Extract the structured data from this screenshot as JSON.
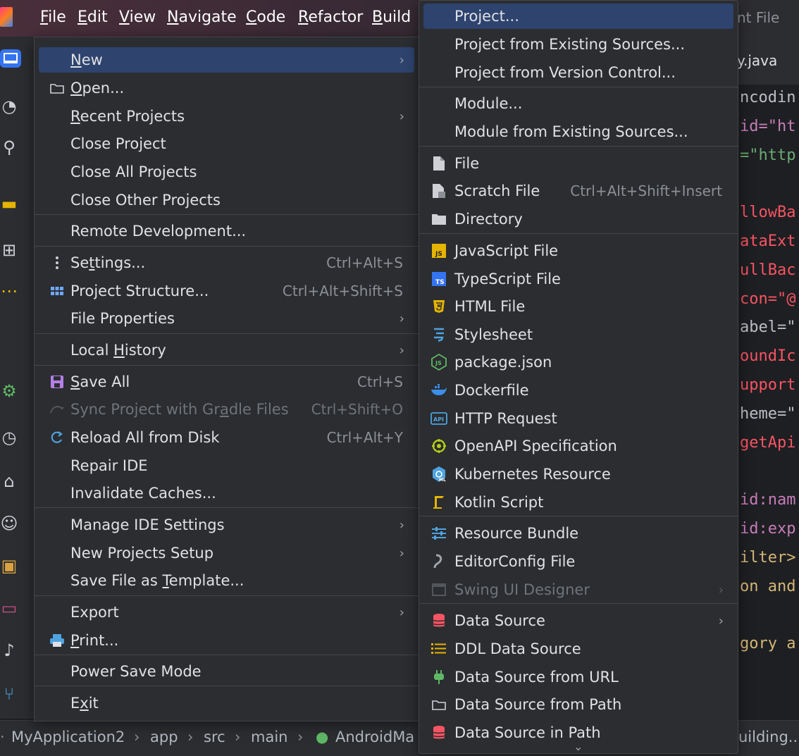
{
  "menubar": {
    "items": [
      "File",
      "Edit",
      "View",
      "Navigate",
      "Code",
      "Refactor",
      "Build"
    ],
    "right_fragment": "nt File"
  },
  "editor": {
    "tab_fragment": "y.java",
    "lines": [
      {
        "text": "ncodin",
        "color": "#bcbec4"
      },
      {
        "text": "id=\"ht",
        "color": "#c77dbb"
      },
      {
        "text": "=\"http",
        "color": "#6aab73"
      },
      {
        "text": "",
        "color": "#bcbec4"
      },
      {
        "text": "llowBa",
        "color": "#f75464"
      },
      {
        "text": "ataExt",
        "color": "#f75464"
      },
      {
        "text": "ullBac",
        "color": "#f75464"
      },
      {
        "text": "con=\"@",
        "color": "#f75464"
      },
      {
        "text": "abel=\"",
        "color": "#bcbec4"
      },
      {
        "text": "oundIc",
        "color": "#f75464"
      },
      {
        "text": "upport",
        "color": "#f75464"
      },
      {
        "text": "heme=\"",
        "color": "#bcbec4"
      },
      {
        "text": "getApi",
        "color": "#f75464"
      },
      {
        "text": "",
        "color": "#bcbec4"
      },
      {
        "text": "id:nam",
        "color": "#c77dbb"
      },
      {
        "text": "id:exp",
        "color": "#c77dbb"
      },
      {
        "text": "ilter>",
        "color": "#d5b778"
      },
      {
        "text": "on and",
        "color": "#d5b778"
      },
      {
        "text": "",
        "color": "#bcbec4"
      },
      {
        "text": "gory a",
        "color": "#d5b778"
      }
    ]
  },
  "statusbar": {
    "breadcrumbs": [
      "MyApplication2",
      "app",
      "src",
      "main",
      "AndroidMa"
    ],
    "right_fragment": "uilding..."
  },
  "file_menu": {
    "items": [
      {
        "label": "New",
        "arrow": true,
        "highlight": true,
        "icon": ""
      },
      {
        "label": "Open...",
        "icon": "folder-icon"
      },
      {
        "label": "Recent Projects",
        "arrow": true
      },
      {
        "label": "Close Project"
      },
      {
        "label": "Close All Projects"
      },
      {
        "label": "Close Other Projects"
      },
      {
        "label": "Remote Development..."
      },
      {
        "label": "Settings...",
        "shortcut": "Ctrl+Alt+S",
        "icon": "more-vertical-icon"
      },
      {
        "label": "Project Structure...",
        "shortcut": "Ctrl+Alt+Shift+S",
        "icon": "grid-icon"
      },
      {
        "label": "File Properties",
        "arrow": true
      },
      {
        "label": "Local History",
        "arrow": true
      },
      {
        "label": "Save All",
        "shortcut": "Ctrl+S",
        "icon": "save-icon"
      },
      {
        "label": "Sync Project with Gradle Files",
        "shortcut": "Ctrl+Shift+O",
        "disabled": true,
        "icon": "gradle-icon"
      },
      {
        "label": "Reload All from Disk",
        "shortcut": "Ctrl+Alt+Y",
        "icon": "reload-icon"
      },
      {
        "label": "Repair IDE"
      },
      {
        "label": "Invalidate Caches..."
      },
      {
        "label": "Manage IDE Settings",
        "arrow": true
      },
      {
        "label": "New Projects Setup",
        "arrow": true
      },
      {
        "label": "Save File as Template..."
      },
      {
        "label": "Export",
        "arrow": true
      },
      {
        "label": "Print...",
        "icon": "printer-icon"
      },
      {
        "label": "Power Save Mode"
      },
      {
        "label": "Exit"
      }
    ]
  },
  "new_menu": {
    "items": [
      {
        "label": "Project...",
        "highlight": true
      },
      {
        "label": "Project from Existing Sources..."
      },
      {
        "label": "Project from Version Control..."
      },
      {
        "label": "Module..."
      },
      {
        "label": "Module from Existing Sources..."
      },
      {
        "label": "File",
        "icon": "file-icon"
      },
      {
        "label": "Scratch File",
        "shortcut": "Ctrl+Alt+Shift+Insert",
        "icon": "scratch-file-icon"
      },
      {
        "label": "Directory",
        "icon": "directory-icon"
      },
      {
        "label": "JavaScript File",
        "icon": "javascript-icon"
      },
      {
        "label": "TypeScript File",
        "icon": "typescript-icon"
      },
      {
        "label": "HTML File",
        "icon": "html-icon"
      },
      {
        "label": "Stylesheet",
        "icon": "css-icon"
      },
      {
        "label": "package.json",
        "icon": "nodejs-icon"
      },
      {
        "label": "Dockerfile",
        "icon": "docker-icon"
      },
      {
        "label": "HTTP Request",
        "icon": "api-icon"
      },
      {
        "label": "OpenAPI Specification",
        "icon": "openapi-icon"
      },
      {
        "label": "Kubernetes Resource",
        "icon": "kubernetes-icon"
      },
      {
        "label": "Kotlin Script",
        "icon": "kotlin-script-icon"
      },
      {
        "label": "Resource Bundle",
        "icon": "resource-bundle-icon"
      },
      {
        "label": "EditorConfig File",
        "icon": "editorconfig-icon"
      },
      {
        "label": "Swing UI Designer",
        "arrow": true,
        "disabled": true,
        "icon": "swing-icon"
      },
      {
        "label": "Data Source",
        "arrow": true,
        "icon": "database-icon"
      },
      {
        "label": "DDL Data Source",
        "icon": "ddl-icon"
      },
      {
        "label": "Data Source from URL",
        "icon": "plug-icon"
      },
      {
        "label": "Data Source from Path",
        "icon": "folder-icon"
      },
      {
        "label": "Data Source in Path",
        "icon": "database-icon"
      }
    ]
  }
}
